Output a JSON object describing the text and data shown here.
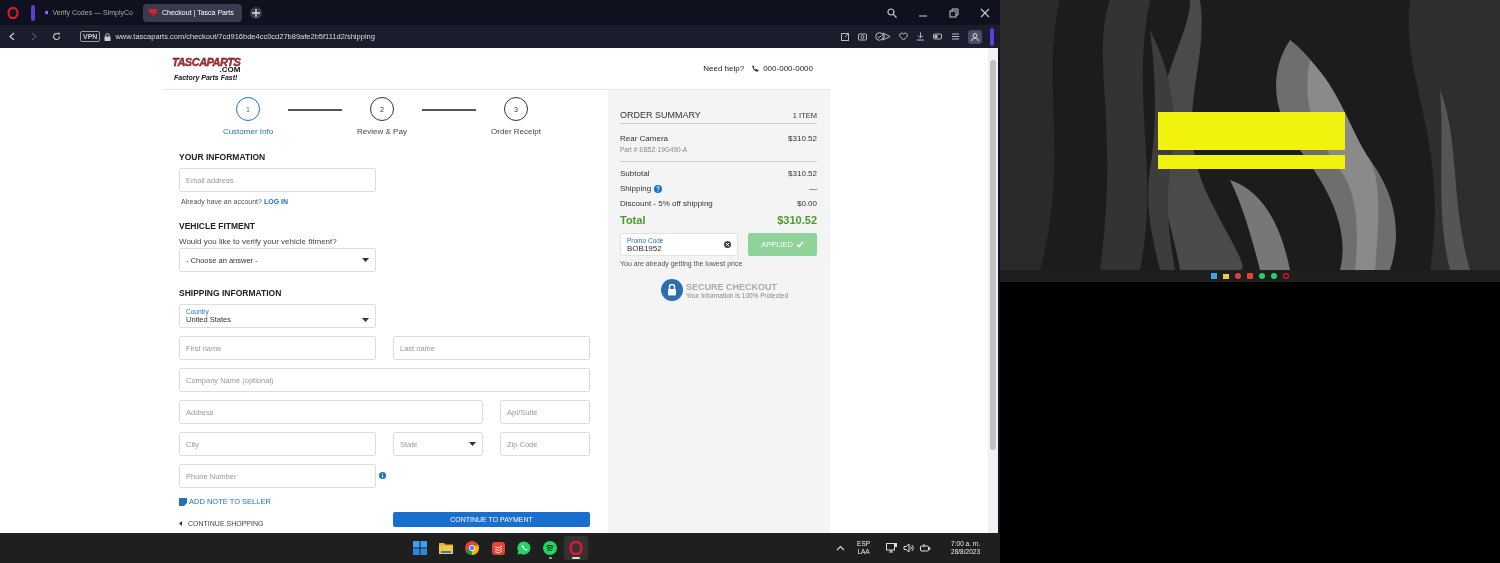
{
  "browser": {
    "tabs": [
      {
        "title": "Verify Codes — SimplyCo",
        "selected": false
      },
      {
        "title": "Checkout | Tasca Parts",
        "selected": true
      }
    ],
    "vpn_badge": "VPN",
    "url": "www.tascaparts.com/checkout/7cd916bde4cc0cd27b89afe2b5f111d2/shipping",
    "can_go_forward": false
  },
  "page": {
    "logo": {
      "name": "TASCAPARTS",
      "domain": ".COM",
      "tagline": "Factory Parts Fast!"
    },
    "help": {
      "label": "Need help?",
      "phone": "000-000-0000"
    },
    "steps": [
      {
        "number": "1",
        "label": "Customer Info",
        "selected": true
      },
      {
        "number": "2",
        "label": "Review & Pay",
        "selected": false
      },
      {
        "number": "3",
        "label": "Order Receipt",
        "selected": false
      }
    ],
    "your_information": {
      "heading": "YOUR INFORMATION",
      "email": {
        "placeholder": "Email address"
      },
      "account_prompt": "Already have an account?",
      "login_link": "LOG IN"
    },
    "vehicle_fitment": {
      "heading": "VEHICLE FITMENT",
      "question": "Would you like to verify your vehicle fitment?",
      "select": {
        "value": "- Choose an answer -"
      }
    },
    "shipping": {
      "heading": "SHIPPING INFORMATION",
      "country": {
        "label": "Country",
        "value": "United States"
      },
      "fields": [
        {
          "kind": "text",
          "placeholder": "First name"
        },
        {
          "kind": "text",
          "placeholder": "Last name"
        },
        {
          "kind": "text",
          "placeholder": "Company Name (optional)"
        },
        {
          "kind": "text",
          "placeholder": "Address"
        },
        {
          "kind": "text",
          "placeholder": "Apt/Suite"
        },
        {
          "kind": "text",
          "placeholder": "City"
        },
        {
          "kind": "select",
          "placeholder": "State"
        },
        {
          "kind": "text",
          "placeholder": "Zip Code"
        },
        {
          "kind": "text",
          "placeholder": "Phone Number",
          "info": true
        }
      ]
    },
    "add_note": "ADD NOTE TO SELLER",
    "continue_shopping": "CONTINUE SHOPPING",
    "continue_button": "CONTINUE TO PAYMENT"
  },
  "order_summary": {
    "title": "ORDER SUMMARY",
    "count": "1 ITEM",
    "items": [
      {
        "name": "Rear Camera",
        "part": "Part # EB5Z-19G490-A",
        "price": "$310.52"
      }
    ],
    "totals": [
      {
        "kind": "line",
        "label": "Subtotal",
        "value": "$310.52",
        "help": false
      },
      {
        "kind": "line",
        "label": "Shipping",
        "value": "—",
        "help": true
      },
      {
        "kind": "line",
        "label": "Discount - 5% off shipping",
        "value": "$0.00",
        "help": false
      },
      {
        "kind": "total",
        "label": "Total",
        "value": "$310.52",
        "help": false
      }
    ],
    "promo": {
      "label": "Promo Code",
      "value": "BOB1952",
      "button": "APPLIED",
      "applied": true,
      "note": "You are already getting the lowest price"
    },
    "secure": {
      "title": "SECURE CHECKOUT",
      "subtitle": "Your Information is 100% Protected"
    }
  },
  "taskbar": {
    "apps": [
      {
        "kind": "windows",
        "running": false,
        "selected": false
      },
      {
        "kind": "folder",
        "running": false,
        "selected": false
      },
      {
        "kind": "chrome",
        "running": false,
        "selected": false
      },
      {
        "kind": "todo",
        "running": false,
        "selected": false
      },
      {
        "kind": "whatsapp",
        "running": false,
        "selected": false
      },
      {
        "kind": "spotify",
        "running": true,
        "selected": false
      },
      {
        "kind": "opera",
        "running": true,
        "selected": true
      }
    ],
    "language": "ESP",
    "layout": "LAA",
    "time": "7:00 a. m.",
    "date": "28/8/2023"
  }
}
